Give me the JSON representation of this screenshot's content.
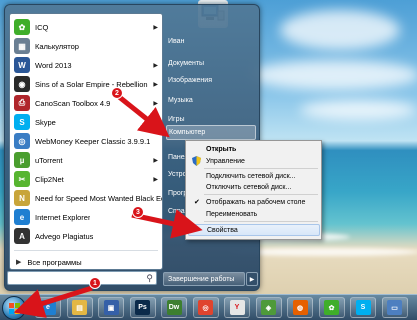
{
  "start_menu": {
    "programs": [
      {
        "label": "ICQ",
        "icon": "icq-icon",
        "color": "#3fae2a",
        "glyph": "✿",
        "has_arrow": true
      },
      {
        "label": "Калькулятор",
        "icon": "calculator-icon",
        "color": "#6a7f93",
        "glyph": "▦",
        "has_arrow": false
      },
      {
        "label": "Word 2013",
        "icon": "word-icon",
        "color": "#2b5797",
        "glyph": "W",
        "has_arrow": true
      },
      {
        "label": "Sins of a Solar Empire - Rebellion",
        "icon": "game-icon",
        "color": "#2a2a2a",
        "glyph": "◉",
        "has_arrow": true
      },
      {
        "label": "CanoScan Toolbox 4.9",
        "icon": "scanner-icon",
        "color": "#b0262c",
        "glyph": "⎙",
        "has_arrow": true
      },
      {
        "label": "Skype",
        "icon": "skype-icon",
        "color": "#00aff0",
        "glyph": "S",
        "has_arrow": true
      },
      {
        "label": "WebMoney Keeper Classic 3.9.9.1",
        "icon": "webmoney-icon",
        "color": "#3a7dc4",
        "glyph": "◎",
        "has_arrow": false
      },
      {
        "label": "uTorrent",
        "icon": "utorrent-icon",
        "color": "#4a9e2e",
        "glyph": "µ",
        "has_arrow": true
      },
      {
        "label": "Clip2Net",
        "icon": "clip2net-icon",
        "color": "#57b530",
        "glyph": "✂",
        "has_arrow": true
      },
      {
        "label": "Need for Speed Most Wanted Black Edition",
        "icon": "nfs-icon",
        "color": "#c8a53a",
        "glyph": "N",
        "has_arrow": false
      },
      {
        "label": "Internet Explorer",
        "icon": "ie-icon",
        "color": "#1f7fd1",
        "glyph": "e",
        "has_arrow": false
      },
      {
        "label": "Advego Plagiatus",
        "icon": "advego-icon",
        "color": "#333333",
        "glyph": "A",
        "has_arrow": false
      }
    ],
    "all_programs": "Все программы",
    "right_links": [
      {
        "label": "Иван",
        "has_arrow": false
      },
      {
        "label": "Документы",
        "has_arrow": false
      },
      {
        "label": "Изображения",
        "has_arrow": false
      },
      {
        "label": "Музыка",
        "has_arrow": false
      },
      {
        "label": "Игры",
        "has_arrow": false
      },
      {
        "label": "Компьютер",
        "has_arrow": false
      },
      {
        "label": "Панел",
        "has_arrow": false
      },
      {
        "label": "Устро",
        "has_arrow": false
      },
      {
        "label": "Прогр",
        "has_arrow": false
      },
      {
        "label": "Справ",
        "has_arrow": false
      }
    ],
    "shutdown": "Завершение работы"
  },
  "context_menu": {
    "items": [
      {
        "label": "Открыть",
        "bold": true,
        "icon": "",
        "checked": false
      },
      {
        "label": "Управление",
        "bold": false,
        "icon": "shield-icon",
        "checked": false
      },
      {
        "label": "Подключить сетевой диск...",
        "bold": false,
        "icon": "",
        "checked": false
      },
      {
        "label": "Отключить сетевой диск...",
        "bold": false,
        "icon": "",
        "checked": false
      },
      {
        "label": "Отображать на рабочем столе",
        "bold": false,
        "icon": "",
        "checked": true
      },
      {
        "label": "Переименовать",
        "bold": false,
        "icon": "",
        "checked": false
      },
      {
        "label": "Свойства",
        "bold": false,
        "icon": "",
        "checked": false
      }
    ]
  },
  "badges": [
    "1",
    "2",
    "3"
  ],
  "taskbar": {
    "items": [
      {
        "name": "ie-taskbar-icon",
        "color": "#1f7fd1",
        "glyph": "e"
      },
      {
        "name": "explorer-taskbar-icon",
        "color": "#e3b744",
        "glyph": "▤"
      },
      {
        "name": "save-taskbar-icon",
        "color": "#3560a8",
        "glyph": "▣"
      },
      {
        "name": "photoshop-taskbar-icon",
        "color": "#0b2a4a",
        "glyph": "Ps"
      },
      {
        "name": "dreamweaver-taskbar-icon",
        "color": "#3d7f2f",
        "glyph": "Dw"
      },
      {
        "name": "chrome-taskbar-icon",
        "color": "#e0442e",
        "glyph": "◎"
      },
      {
        "name": "yandex-taskbar-icon",
        "color": "#e6e6e6",
        "glyph": "Y"
      },
      {
        "name": "maps-taskbar-icon",
        "color": "#4e9a3a",
        "glyph": "◈"
      },
      {
        "name": "firefox-taskbar-icon",
        "color": "#e66000",
        "glyph": "◍"
      },
      {
        "name": "icq-taskbar-icon",
        "color": "#3fae2a",
        "glyph": "✿"
      },
      {
        "name": "skype-taskbar-icon",
        "color": "#00aff0",
        "glyph": "S"
      },
      {
        "name": "chat-taskbar-icon",
        "color": "#4d7fc0",
        "glyph": "▭"
      }
    ]
  },
  "colors": {
    "annotation_red": "#d9141a",
    "menu_highlight": "#d8e7f8"
  }
}
